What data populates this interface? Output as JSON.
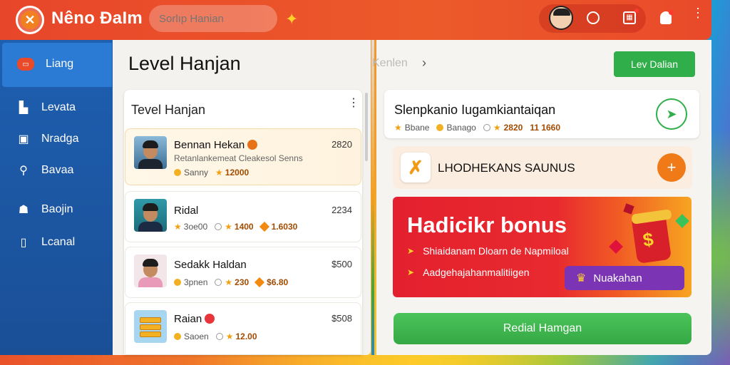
{
  "header": {
    "app_name": "Nêno ĐaIm",
    "search_placeholder": "Sorlıp Hanian",
    "icons": [
      "logo-icon",
      "puzzle-icon",
      "avatar",
      "circle-icon",
      "calendar-icon",
      "user-icon",
      "more-icon"
    ]
  },
  "sidebar": {
    "items": [
      {
        "label": "Liang",
        "icon": "home-icon"
      },
      {
        "label": "Levata",
        "icon": "building-icon"
      },
      {
        "label": "Nradga",
        "icon": "box-icon"
      },
      {
        "label": "Bavaa",
        "icon": "search-icon"
      },
      {
        "label": "Baojin",
        "icon": "user-icon"
      },
      {
        "label": "Lcanal",
        "icon": "document-icon"
      }
    ]
  },
  "middle": {
    "title": "Level Hanjan",
    "card_title": "Tevel Hanjan",
    "rows": [
      {
        "name": "Bennan Hekan",
        "sub": "Retanlankemeat Cleakesol Senns",
        "stat1": "Sanny",
        "stat2": "12000",
        "score": "2820"
      },
      {
        "name": "Ridal",
        "sub": "",
        "stat1": "3oe00",
        "stat2": "1400",
        "stat3": "1.6030",
        "score": "2234"
      },
      {
        "name": "Sedakk Haldan",
        "sub": "",
        "stat1": "3pnen",
        "stat2": "230",
        "stat3": "$6.80",
        "score": "$500"
      },
      {
        "name": "Raian",
        "sub": "",
        "stat1": "Saoen",
        "stat2": "12.00",
        "score": "$508"
      }
    ]
  },
  "right": {
    "crumb": "Kenlen",
    "top_button": "Lev Dalian",
    "card1": {
      "title": "Slenpkanio Iugamkiantaiqan",
      "meta1": "Bbane",
      "meta2": "Banago",
      "meta3": "2820",
      "meta4": "11 1660"
    },
    "card2": {
      "title": "LHODHEKANS SAUNUS"
    },
    "promo": {
      "title": "Hadicikr bonus",
      "line1": "Shiaidanam Dloarn de Napmiloal",
      "line2": "Aadgehajahanmalitiigen",
      "button": "Nuakahan"
    },
    "bottom_button": "Redial Hamgan"
  }
}
